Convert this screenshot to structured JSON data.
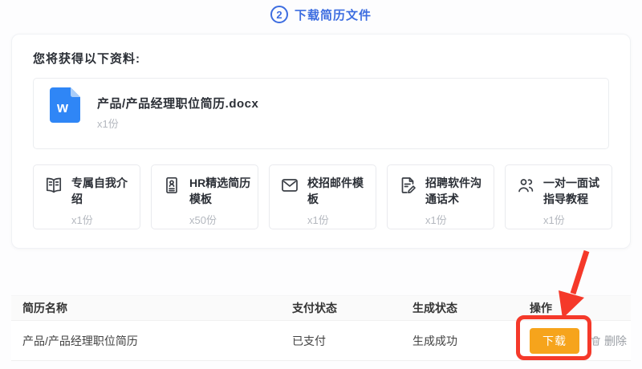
{
  "step": {
    "number": "2",
    "label": "下载简历文件"
  },
  "panel": {
    "title": "您将获得以下资料:",
    "main_file": {
      "name": "产品/产品经理职位简历.docx",
      "count": "x1份",
      "type": "word-document",
      "letter": "w"
    },
    "bonus_items": [
      {
        "icon": "open-book-icon",
        "label": "专属自我介绍",
        "count": "x1份"
      },
      {
        "icon": "id-card-icon",
        "label": "HR精选简历模板",
        "count": "x50份"
      },
      {
        "icon": "envelope-icon",
        "label": "校招邮件模板",
        "count": "x1份"
      },
      {
        "icon": "document-pencil-icon",
        "label": "招聘软件沟通话术",
        "count": "x1份"
      },
      {
        "icon": "two-people-icon",
        "label": "一对一面试指导教程",
        "count": "x1份"
      }
    ]
  },
  "table": {
    "headers": [
      "简历名称",
      "支付状态",
      "生成状态",
      "操作"
    ],
    "rows": [
      {
        "name": "产品/产品经理职位简历",
        "payment_status": "已支付",
        "generation_status": "生成成功",
        "download_label": "下载",
        "delete_label": "删除"
      }
    ]
  },
  "colors": {
    "accent_blue": "#3d6de0",
    "download_orange": "#f6a41c",
    "annotation_red": "#f5392a",
    "word_icon_blue": "#2f86f6"
  }
}
